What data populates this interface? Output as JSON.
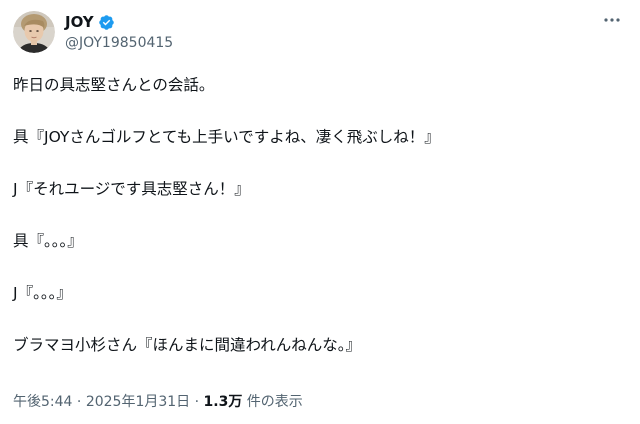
{
  "author": {
    "display_name": "JOY",
    "handle": "@JOY19850415",
    "verified": true
  },
  "colors": {
    "verified_blue": "#1d9bf0",
    "text_primary": "#0f1419",
    "text_secondary": "#536471"
  },
  "tweet": {
    "lines": [
      "昨日の具志堅さんとの会話。",
      "具『JOYさんゴルフとても上手いですよね、凄く飛ぶしね！』",
      "J『それユージです具志堅さん！』",
      "具『。。。』",
      "J『。。。』",
      "ブラマヨ小杉さん『ほんまに間違われんねんな。』"
    ]
  },
  "meta": {
    "time": "午後5:44",
    "sep1": " · ",
    "date": "2025年1月31日",
    "sep2": " · ",
    "views_count": "1.3万",
    "views_label": " 件の表示"
  },
  "icons": {
    "avatar": "avatar-photo",
    "verified": "verified-badge-icon",
    "more": "more-options-icon"
  }
}
